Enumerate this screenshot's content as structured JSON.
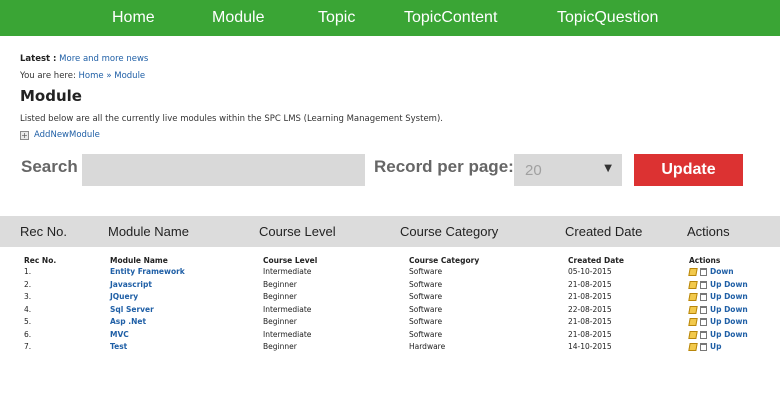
{
  "nav": {
    "items": [
      "Home",
      "Module",
      "Topic",
      "TopicContent",
      "TopicQuestion"
    ]
  },
  "latest": {
    "label": "Latest :",
    "link": "More and more news"
  },
  "breadcrumb": {
    "prefix": "You are here:",
    "home": "Home",
    "sep": "»",
    "current": "Module"
  },
  "page": {
    "title": "Module",
    "description": "Listed below are all the currently live modules within the SPC LMS (Learning Management System).",
    "add_new": "AddNewModule"
  },
  "search": {
    "label": "Search",
    "value": ""
  },
  "records": {
    "label": "Record per page:",
    "selected": "20"
  },
  "update_label": "Update",
  "grid_headers": [
    "Rec No.",
    "Module Name",
    "Course Level",
    "Course Category",
    "Created Date",
    "Actions"
  ],
  "table": {
    "headers": [
      "Rec No.",
      "Module Name",
      "Course Level",
      "Course Category",
      "Created Date",
      "Actions"
    ],
    "rows": [
      {
        "rec": "1.",
        "name": "Entity Framework",
        "level": "Intermediate",
        "category": "Software",
        "date": "05-10-2015",
        "action": "Down"
      },
      {
        "rec": "2.",
        "name": "Javascript",
        "level": "Beginner",
        "category": "Software",
        "date": "21-08-2015",
        "action": "Up Down"
      },
      {
        "rec": "3.",
        "name": "JQuery",
        "level": "Beginner",
        "category": "Software",
        "date": "21-08-2015",
        "action": "Up Down"
      },
      {
        "rec": "4.",
        "name": "Sql Server",
        "level": "Intermediate",
        "category": "Software",
        "date": "22-08-2015",
        "action": "Up Down"
      },
      {
        "rec": "5.",
        "name": "Asp .Net",
        "level": "Beginner",
        "category": "Software",
        "date": "21-08-2015",
        "action": "Up Down"
      },
      {
        "rec": "6.",
        "name": "MVC",
        "level": "Intermediate",
        "category": "Software",
        "date": "21-08-2015",
        "action": "Up Down"
      },
      {
        "rec": "7.",
        "name": "Test",
        "level": "Beginner",
        "category": "Hardware",
        "date": "14-10-2015",
        "action": "Up"
      }
    ]
  },
  "colors": {
    "nav_bg": "#3aa535",
    "update_bg": "#dc3232",
    "link": "#1f5fa6",
    "grid_head_bg": "#dcdcdc"
  }
}
